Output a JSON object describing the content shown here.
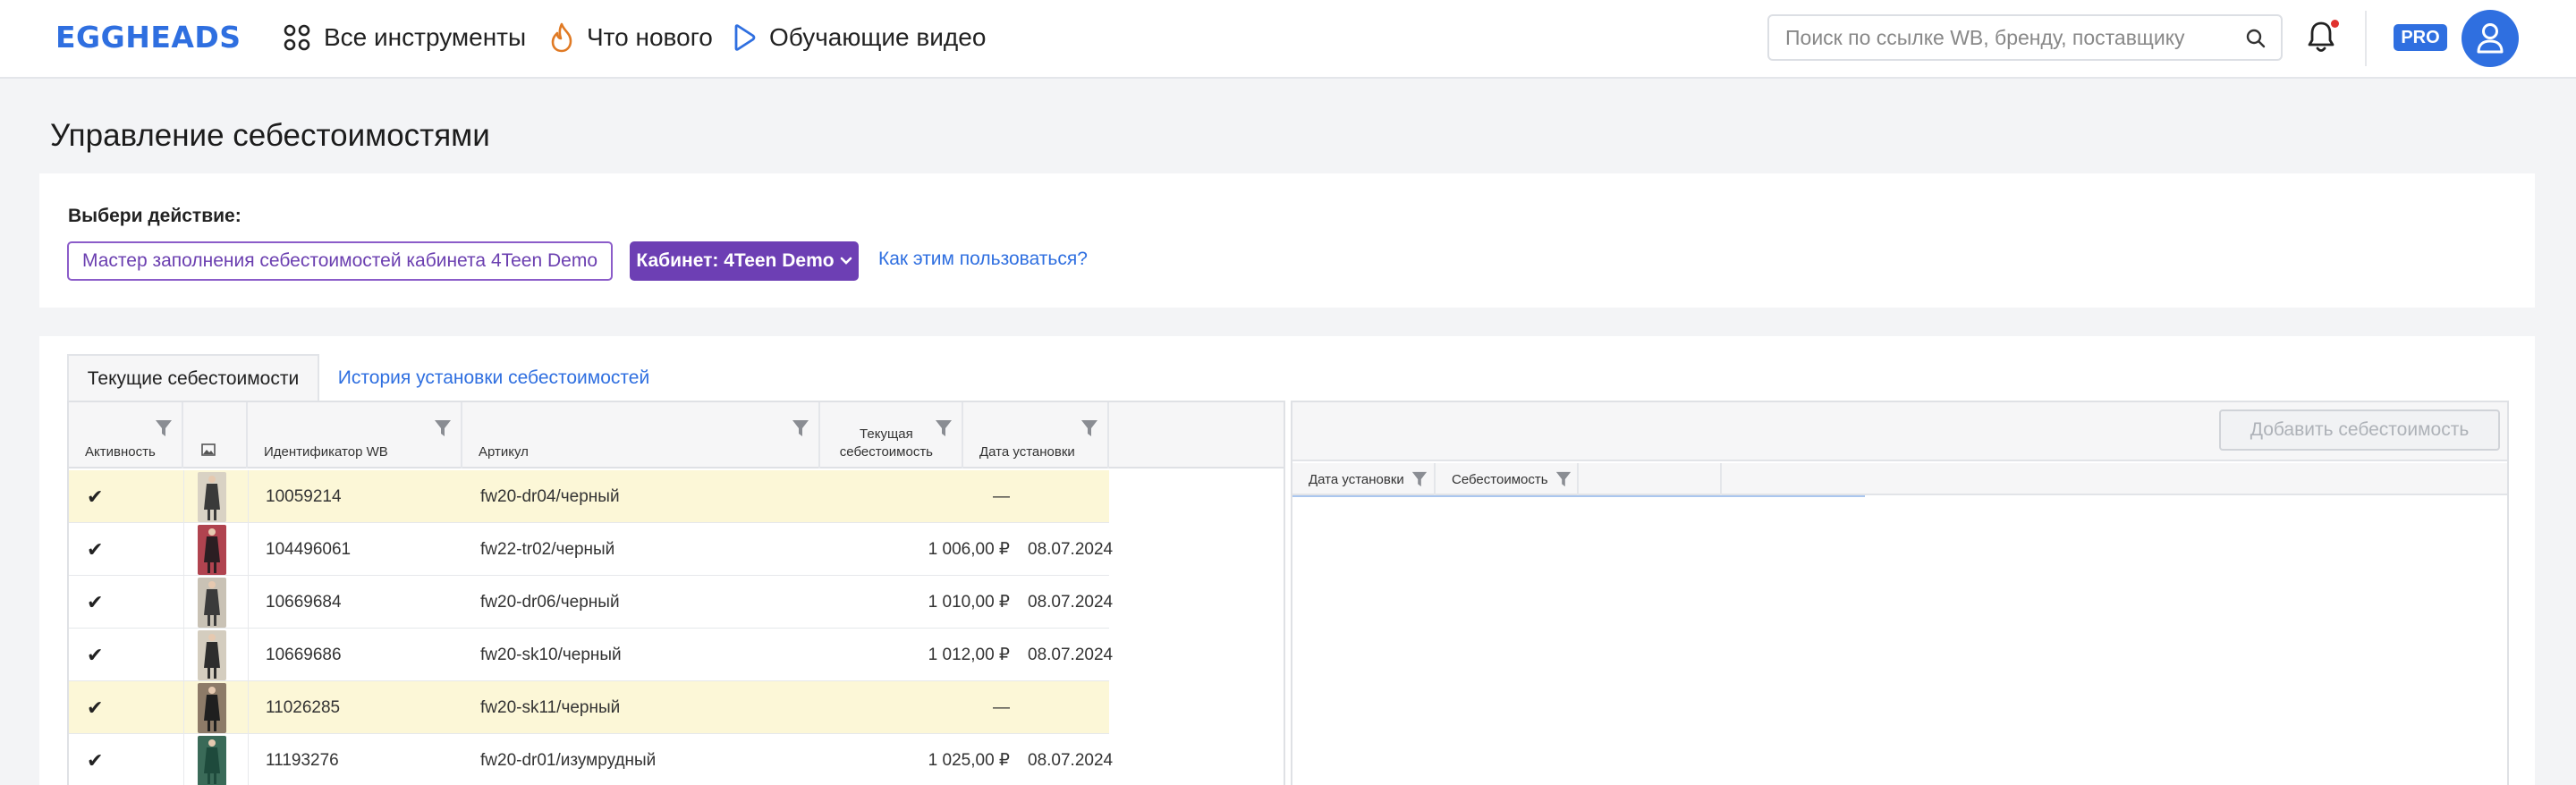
{
  "header": {
    "logo": "EGGHEADS",
    "nav": [
      {
        "label": "Все инструменты",
        "icon": "grid-icon"
      },
      {
        "label": "Что нового",
        "icon": "flame-icon"
      },
      {
        "label": "Обучающие видео",
        "icon": "play-icon"
      }
    ],
    "search_placeholder": "Поиск по ссылке WB, бренду, поставщику",
    "pro_badge": "PRO"
  },
  "page_title": "Управление себестоимостями",
  "action_card": {
    "label": "Выбери действие:",
    "wizard_button": "Мастер заполнения себестоимостей кабинета 4Teen Demo",
    "cabinet_button": "Кабинет: 4Teen Demo",
    "howto_link": "Как этим пользоваться?"
  },
  "tabs": [
    {
      "label": "Текущие себестоимости",
      "active": true
    },
    {
      "label": "История установки себестоимостей",
      "active": false
    }
  ],
  "grid": {
    "columns": {
      "activity": "Активность",
      "wb_id": "Идентификатор WB",
      "article": "Артикул",
      "cost_line1": "Текущая",
      "cost_line2": "себестоимость",
      "date": "Дата установки"
    },
    "rows": [
      {
        "check": "✔",
        "id": "10059214",
        "article": "fw20-dr04/черный",
        "cost": "—",
        "date": "",
        "highlight": true
      },
      {
        "check": "✔",
        "id": "104496061",
        "article": "fw22-tr02/черный",
        "cost": "1 006,00 ₽",
        "date": "08.07.2024",
        "highlight": false
      },
      {
        "check": "✔",
        "id": "10669684",
        "article": "fw20-dr06/черный",
        "cost": "1 010,00 ₽",
        "date": "08.07.2024",
        "highlight": false
      },
      {
        "check": "✔",
        "id": "10669686",
        "article": "fw20-sk10/черный",
        "cost": "1 012,00 ₽",
        "date": "08.07.2024",
        "highlight": false
      },
      {
        "check": "✔",
        "id": "11026285",
        "article": "fw20-sk11/черный",
        "cost": "—",
        "date": "",
        "highlight": true
      },
      {
        "check": "✔",
        "id": "11193276",
        "article": "fw20-dr01/изумрудный",
        "cost": "1 025,00 ₽",
        "date": "08.07.2024",
        "highlight": false
      }
    ]
  },
  "right_panel": {
    "add_button": "Добавить себестоимость",
    "columns": {
      "date": "Дата установки",
      "cost": "Себестоимость"
    }
  },
  "colors": {
    "brand": "#2f6fe0",
    "accent": "#6d3fb4",
    "highlight": "#fcf7d7"
  }
}
